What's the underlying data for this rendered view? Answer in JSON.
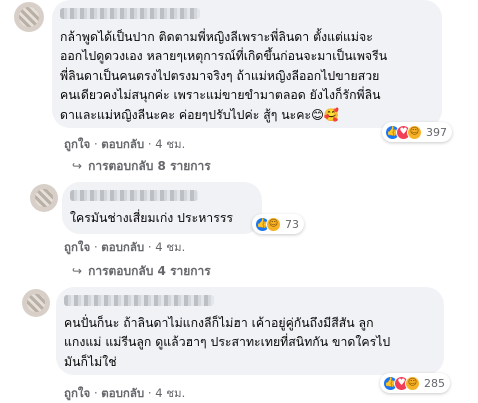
{
  "comments": [
    {
      "lines": [
        "กล้าพูดได้เป็นปาก ติดตามพี่หญิงลีเพราะพี่ลินดา ตั้งแต่แม่จะ",
        "ออกไปดูดวงเอง หลายๆเหตุการณ์ที่เกิดขึ้นก่อนจะมาเป็นเพจรีน",
        "พี่ลินดาเป็นคนตรงไปตรงมาจริงๆ ถ้าแม่หญิงลีออกไปขายสวย",
        "คนเดียวคงไม่สนุกค่ะ เพราะแม่ขายขำมาตลอด ยังไงก็รักพี่ลิน",
        "ดาและแม่หญิงลีนะคะ ค่อยๆปรับไปค่ะ สู้ๆ นะคะ😊🥰"
      ],
      "reaction_count": "397",
      "reactions": [
        "like",
        "love",
        "haha"
      ],
      "like_label": "ถูกใจ",
      "reply_label": "ตอบกลับ",
      "time": "4 ชม.",
      "replies_label": "การตอบกลับ 8 รายการ"
    },
    {
      "lines": [
        "ใครมันช่างเสี่ยมเก่ง ประหารรร"
      ],
      "reaction_count": "73",
      "reactions": [
        "like",
        "haha"
      ],
      "like_label": "ถูกใจ",
      "reply_label": "ตอบกลับ",
      "time": "4 ชม.",
      "replies_label": "การตอบกลับ 4 รายการ"
    },
    {
      "lines": [
        "คนปั่นก็นะ ถ้าลินดาไม่แกงลีก็ไม่ฮา เค้าอยู่คู่กันถึงมีสีสัน ลูก",
        "แกงแม่ แม่รีนลูก ดูแล้วฮาๆ ประสาทะเทยที่สนิทกัน ขาดใครไป",
        "มันก็ไม่ใช่"
      ],
      "reaction_count": "285",
      "reactions": [
        "like",
        "love",
        "haha"
      ],
      "like_label": "ถูกใจ",
      "reply_label": "ตอบกลับ",
      "time": "4 ชม."
    }
  ],
  "separator": "·",
  "colors": {
    "like": "#1877f2",
    "love": "#f33e58",
    "haha": "#f7b125",
    "meta": "#65676b",
    "bubble": "#f0f2f5"
  }
}
